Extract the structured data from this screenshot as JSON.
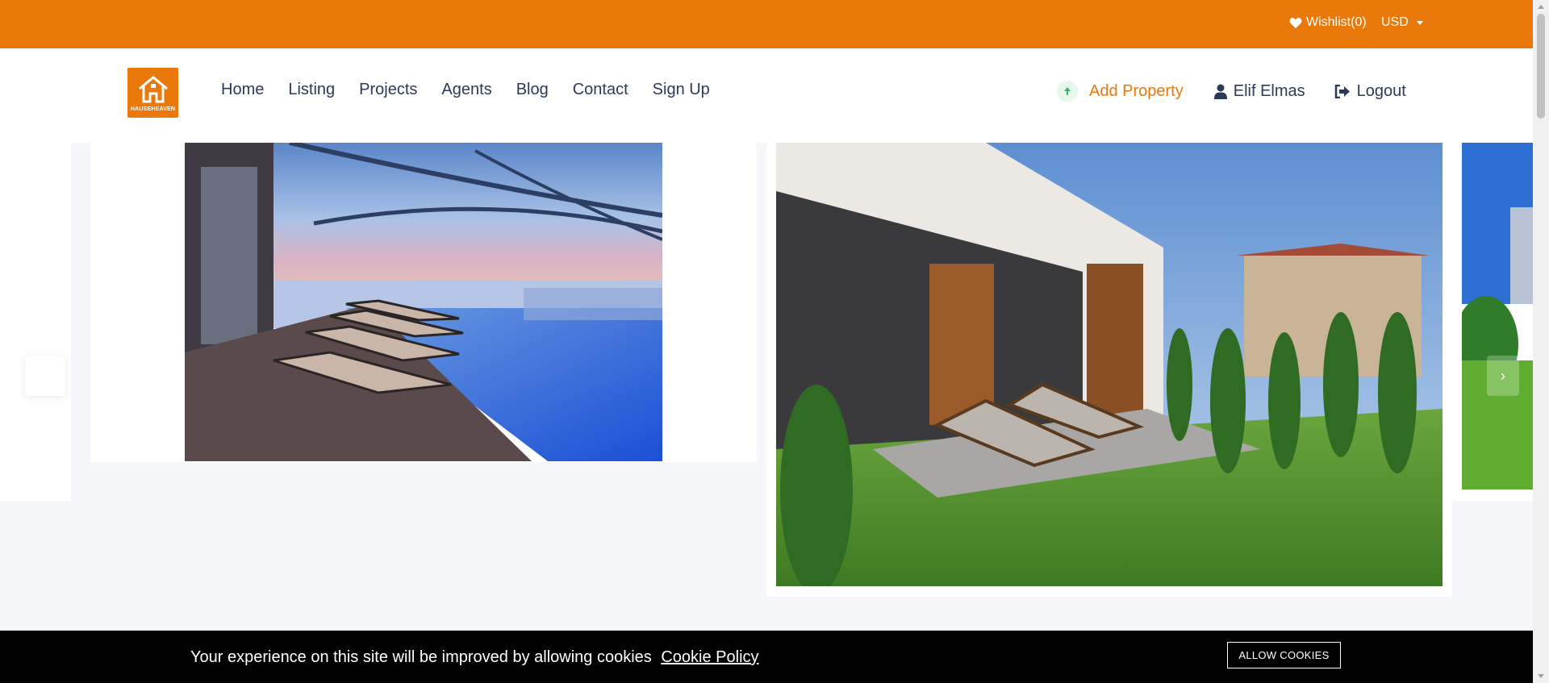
{
  "topbar": {
    "wishlist_label": "Wishlist(0)",
    "currency_label": "USD",
    "bg_color": "#e8790a"
  },
  "header": {
    "logo_text": "HAUSEHEAVEN",
    "nav": [
      {
        "label": "Home"
      },
      {
        "label": "Listing"
      },
      {
        "label": "Projects"
      },
      {
        "label": "Agents"
      },
      {
        "label": "Blog"
      },
      {
        "label": "Contact"
      },
      {
        "label": "Sign Up"
      }
    ],
    "add_property_label": "Add Property",
    "user_label": "Elif Elmas",
    "logout_label": "Logout"
  },
  "slider": {
    "images": [
      {
        "name": "rooftop-pool-image",
        "icon": "pool-photo"
      },
      {
        "name": "villa-terrace-image",
        "icon": "villa-photo"
      },
      {
        "name": "next-property-image",
        "icon": "garden-photo"
      }
    ],
    "arrow_right_glyph": "›"
  },
  "cookie": {
    "message": "Your experience on this site will be improved by allowing cookies",
    "policy_link": "Cookie Policy",
    "button": "ALLOW COOKIES"
  }
}
